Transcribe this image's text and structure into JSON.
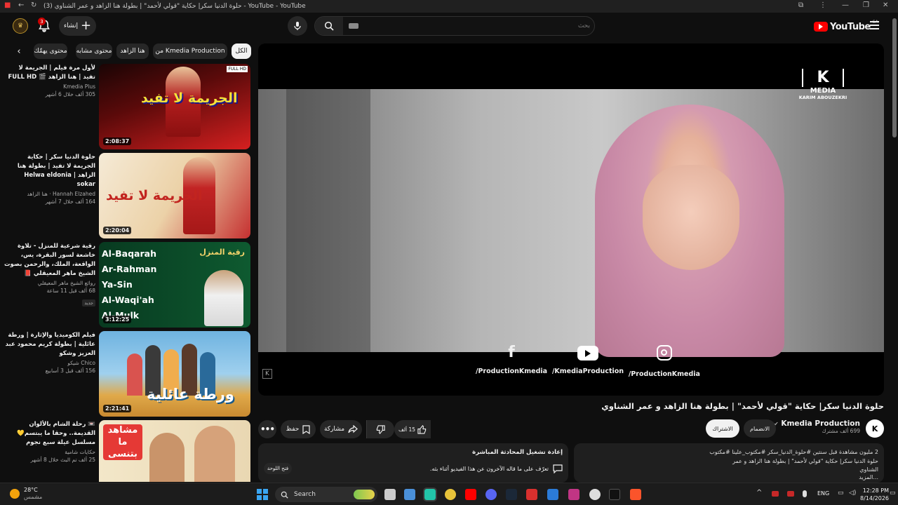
{
  "window": {
    "title": "حلوة الدنيا سكر| حكاية \"قولي لأحمد\" | بطولة هنا الزاهد و عمر الشناوي (3) - YouTube - YouTube"
  },
  "masthead": {
    "logo_text": "YouTube",
    "logo_region": "SA",
    "search_placeholder": "بحث",
    "create_label": "إنشاء",
    "notification_count": "3"
  },
  "chips": {
    "all": "الكل",
    "from_channel": "من Kmedia Production",
    "hana": "هنا الزاهد",
    "similar": "محتوى مشابه",
    "interesting": "محتوى يهمّك"
  },
  "recommendations": [
    {
      "title": "لأول مرة فيلم | الجريمة لا تفيد | هنا الزاهد 🎬 FULL HD",
      "channel": "Kmedia Plus",
      "stats": "305 ألف  خلال 6 أشهر",
      "duration": "2:08:37",
      "thumb_text": "الجريمة لا تفيد",
      "thumb_colors": [
        "#3a0a0a",
        "#d62020"
      ]
    },
    {
      "title": "حلوة الدنيا سكر | حكاية الجريمة لا تفيد | بطولة هنا الزاهد | Helwa eldonia sokar",
      "channel": "Hannah Elzahed · هنا الزاهد",
      "stats": "164 ألف  خلال 7 أشهر",
      "duration": "2:20:04",
      "thumb_text": "الجريمة لا تفيد",
      "thumb_colors": [
        "#f3e3c9",
        "#c72a2a"
      ]
    },
    {
      "title": "رقية شرعية للمنزل  - تلاوة خاشعة لسور البقرة، يس، الواقعة، الملك، والرحمن بصوت الشيخ ماهر المعيقلي 📕",
      "channel": "روائع الشيخ ماهر المعيقلي",
      "stats": "68 ألف  قبل 11 ساعة",
      "badge": "جديد",
      "duration": "3:12:25",
      "thumb_text": "رقية المنزل",
      "surahs": [
        "Al-Baqarah",
        "Ar-Rahman",
        "Ya-Sin",
        "Al-Waqi'ah",
        "Al-Mulk"
      ],
      "thumb_colors": [
        "#0b4a2a",
        "#1e7a3e"
      ]
    },
    {
      "title": "فيلم الكوميديا والإثارة | ورطة عائلية | بطولة كريم محمود عبد العزيز وشكو",
      "channel": "Chico شيكو",
      "stats": "156 ألف  قبل 3 أسابيع",
      "duration": "2:21:41",
      "thumb_text": "ورطة عائلية",
      "thumb_colors": [
        "#5ba6d8",
        "#e8b24a"
      ]
    },
    {
      "title": "📼 رحلة الشام بالألوان القديمة.. وحقا ما يبتسم💛 مسلسل عيلة سبع نجوم",
      "channel": "حكايات شامية",
      "stats": "25 ألف  تم البث خلال 8 أشهر",
      "duration": "",
      "thumb_text": "مشاهد ما بتنسى",
      "thumb_colors": [
        "#f2e6c8",
        "#e53935"
      ]
    }
  ],
  "player": {
    "watermark_brand": "MEDIA",
    "watermark_name": "KARIM ABOUZEKRI",
    "social_links": [
      {
        "icon": "facebook-icon",
        "text": "/ProductionKmedia"
      },
      {
        "icon": "youtube-icon",
        "text": "/KmediaProduction"
      },
      {
        "icon": "instagram-icon",
        "text": "/ProductionKmedia"
      }
    ]
  },
  "video": {
    "title": "حلوة الدنيا سكر| حكاية \"قولي لأحمد\" | بطولة هنا الزاهد و عمر الشناوي",
    "channel": "Kmedia Production",
    "subscribers": "699 ألف مشترك",
    "join_label": "الانضمام",
    "subscribe_label": "الاشتراك",
    "likes": "15 ألف",
    "share_label": "مشاركة",
    "save_label": "حفظ"
  },
  "description": {
    "stats": "2 مليون مشاهدة  قبل سنتين  #حلوة_الدنيا_سكر #مكتوب_علينا #مكتوب",
    "text": "حلوة الدنيا سكر| حكاية \"قولي لأحمد\" | بطولة هنا الزاهد و عمر الشناوي",
    "more": "...المزيد"
  },
  "live_chat": {
    "title": "إعادة تشغيل المحادثة المباشرة",
    "subtitle": "تعرّف على ما قاله الآخرون عن هذا الفيديو أثناء بثه.",
    "button": "فتح اللوحة"
  },
  "taskbar": {
    "weather_temp": "28°C",
    "weather_desc": "مشمس",
    "search_label": "Search",
    "lang": "ENG",
    "time": "12:28 PM",
    "date": "8/14/2026"
  }
}
